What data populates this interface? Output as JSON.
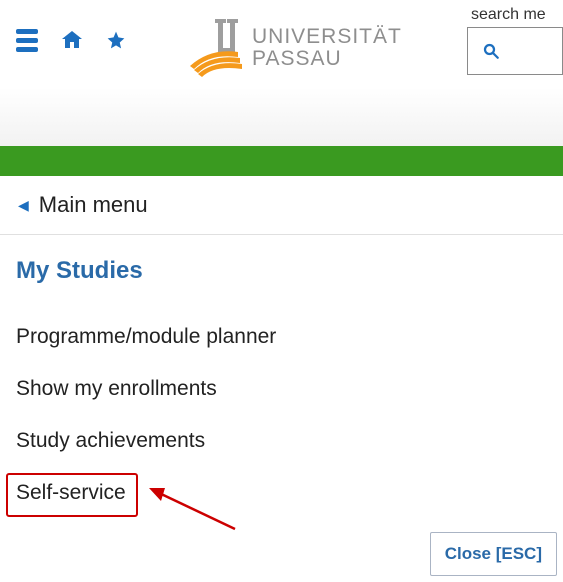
{
  "header": {
    "search_label": "search me",
    "logo_line1": "UNIVERSITÄT",
    "logo_line2": "PASSAU"
  },
  "breadcrumb": {
    "label": "Main menu"
  },
  "section": {
    "title": "My Studies",
    "items": [
      {
        "label": "Programme/module planner"
      },
      {
        "label": "Show my enrollments"
      },
      {
        "label": "Study achievements"
      },
      {
        "label": "Self-service"
      }
    ]
  },
  "footer": {
    "close_label": "Close [ESC]"
  }
}
